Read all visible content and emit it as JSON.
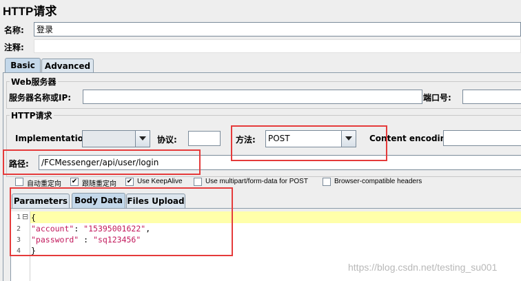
{
  "window": {
    "title": "HTTP请求"
  },
  "name": {
    "label": "名称:",
    "value": "登录"
  },
  "comment": {
    "label": "注释:",
    "value": ""
  },
  "tabs": {
    "basic": "Basic",
    "advanced": "Advanced"
  },
  "web_server": {
    "legend": "Web服务器",
    "server_label": "服务器名称或IP:",
    "server_value": "",
    "port_label": "端口号:",
    "port_value": ""
  },
  "http_request": {
    "legend": "HTTP请求",
    "implementation_label": "Implementation:",
    "implementation_value": "",
    "protocol_label": "协议:",
    "protocol_value": "",
    "method_label": "方法:",
    "method_value": "POST",
    "encoding_label": "Content encoding:",
    "encoding_value": "",
    "path_label": "路径:",
    "path_value": "/FCMessenger/api/user/login"
  },
  "options": [
    {
      "label": "自动重定向",
      "checked": false
    },
    {
      "label": "跟随重定向",
      "checked": true
    },
    {
      "label": "Use KeepAlive",
      "checked": true
    },
    {
      "label": "Use multipart/form-data for POST",
      "checked": false
    },
    {
      "label": "Browser-compatible headers",
      "checked": false
    }
  ],
  "body_tabs": {
    "parameters": "Parameters",
    "body_data": "Body Data",
    "files_upload": "Files Upload"
  },
  "editor": {
    "line_numbers": [
      "1",
      "2",
      "3",
      "4"
    ],
    "fold_marker": "⊟",
    "line1": "{",
    "line2_key": "\"account\"",
    "line2_sep": ": ",
    "line2_val": "\"15395001622\"",
    "line2_end": ",",
    "line3_key": "\"password\"",
    "line3_sep": " : ",
    "line3_val": "\"sq123456\"",
    "line4": "}"
  },
  "watermark": "https://blog.csdn.net/testing_su001",
  "colors": {
    "accent_red": "#e53a3a",
    "json_string": "#c2185b",
    "highlight_line": "#ffffaa"
  }
}
